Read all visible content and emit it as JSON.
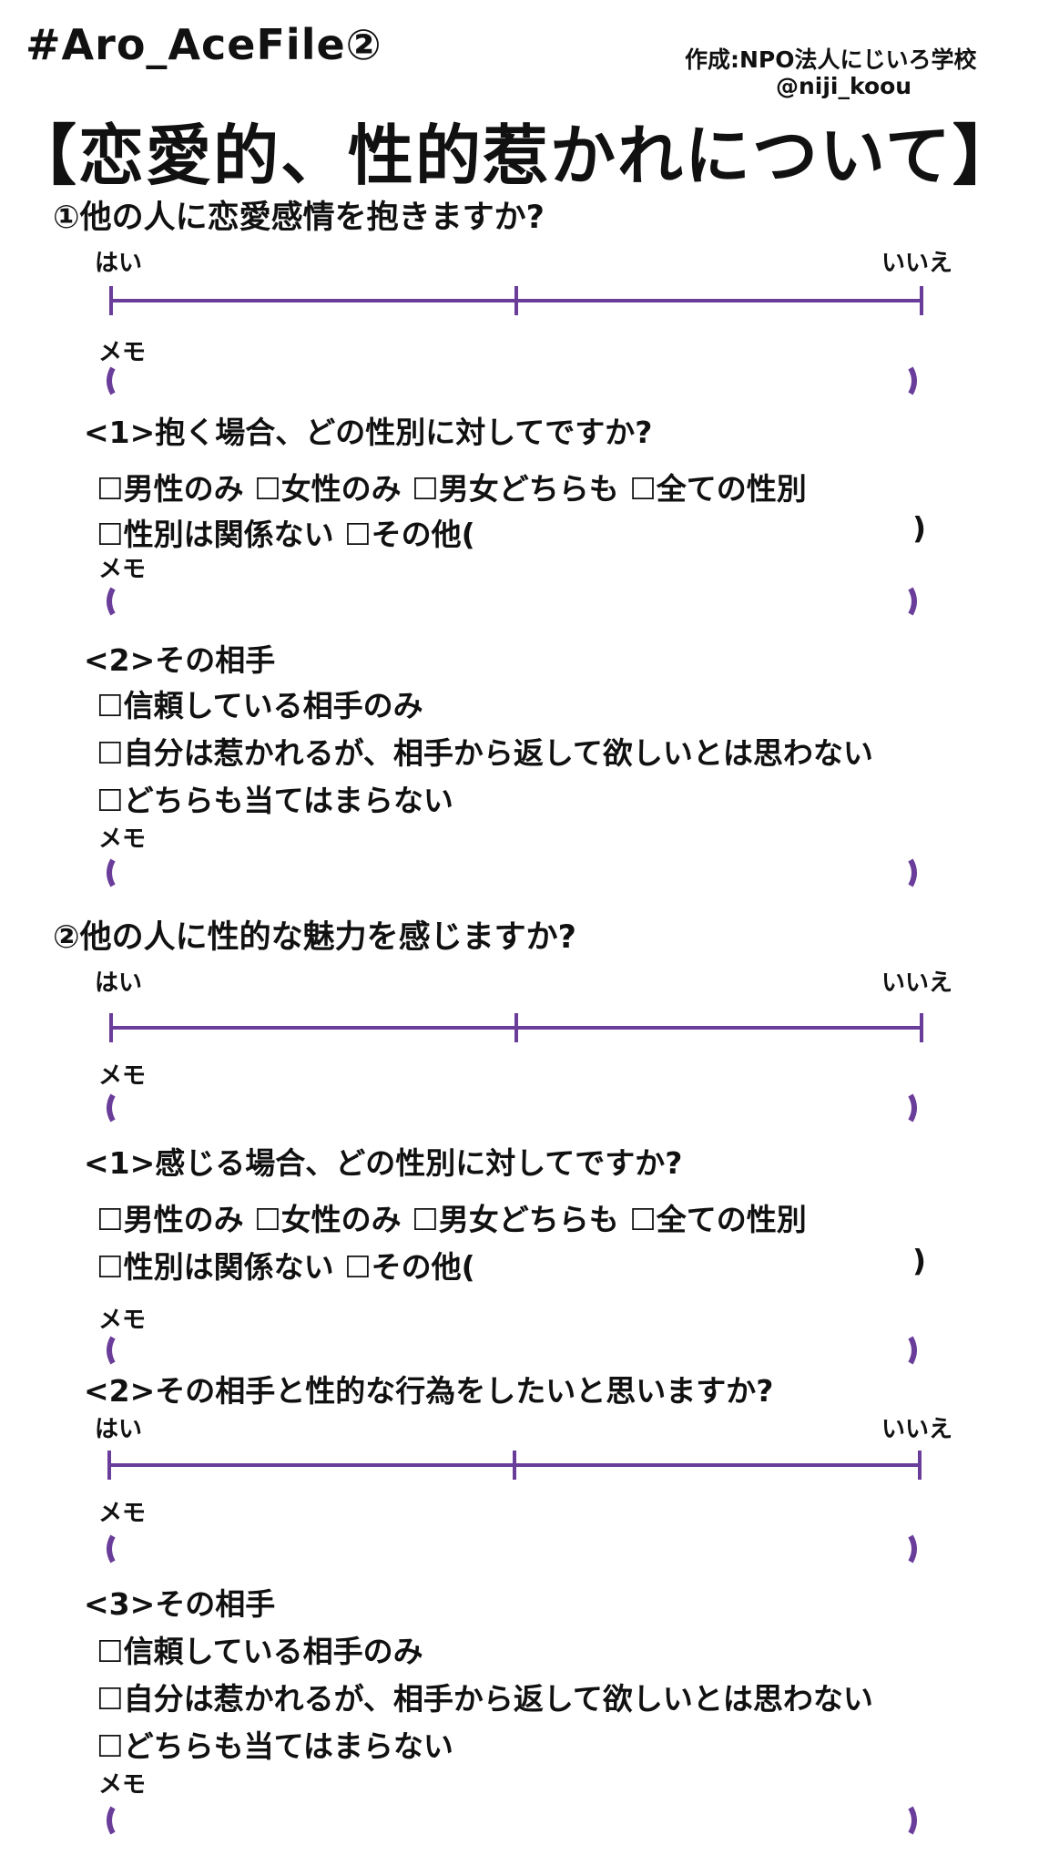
{
  "header": {
    "hashtag": "#Aro_AceFile②",
    "credit": "作成:NPO法人にじいろ学校",
    "handle": "@niji_koou",
    "title": "【恋愛的、性的惹かれについて】"
  },
  "colors": {
    "scale": "#6a3d9a",
    "text": "#111111"
  },
  "labels": {
    "yes": "はい",
    "no": "いいえ",
    "memo": "メモ",
    "other_close": ")"
  },
  "section1": {
    "question": "①他の人に恋愛感情を抱きますか?",
    "sub1": {
      "title": "<1>抱く場合、どの性別に対してですか?",
      "row1": "☐男性のみ ☐女性のみ ☐男女どちらも ☐全ての性別",
      "row2": "☐性別は関係ない ☐その他("
    },
    "sub2": {
      "title": "<2>その相手",
      "options": [
        "☐信頼している相手のみ",
        "☐自分は惹かれるが、相手から返して欲しいとは思わない",
        "☐どちらも当てはまらない"
      ]
    }
  },
  "section2": {
    "question": "②他の人に性的な魅力を感じますか?",
    "sub1": {
      "title": "<1>感じる場合、どの性別に対してですか?",
      "row1": "☐男性のみ ☐女性のみ ☐男女どちらも ☐全ての性別",
      "row2": "☐性別は関係ない ☐その他("
    },
    "sub2": {
      "title": "<2>その相手と性的な行為をしたいと思いますか?"
    },
    "sub3": {
      "title": "<3>その相手",
      "options": [
        "☐信頼している相手のみ",
        "☐自分は惹かれるが、相手から返して欲しいとは思わない",
        "☐どちらも当てはまらない"
      ]
    }
  }
}
